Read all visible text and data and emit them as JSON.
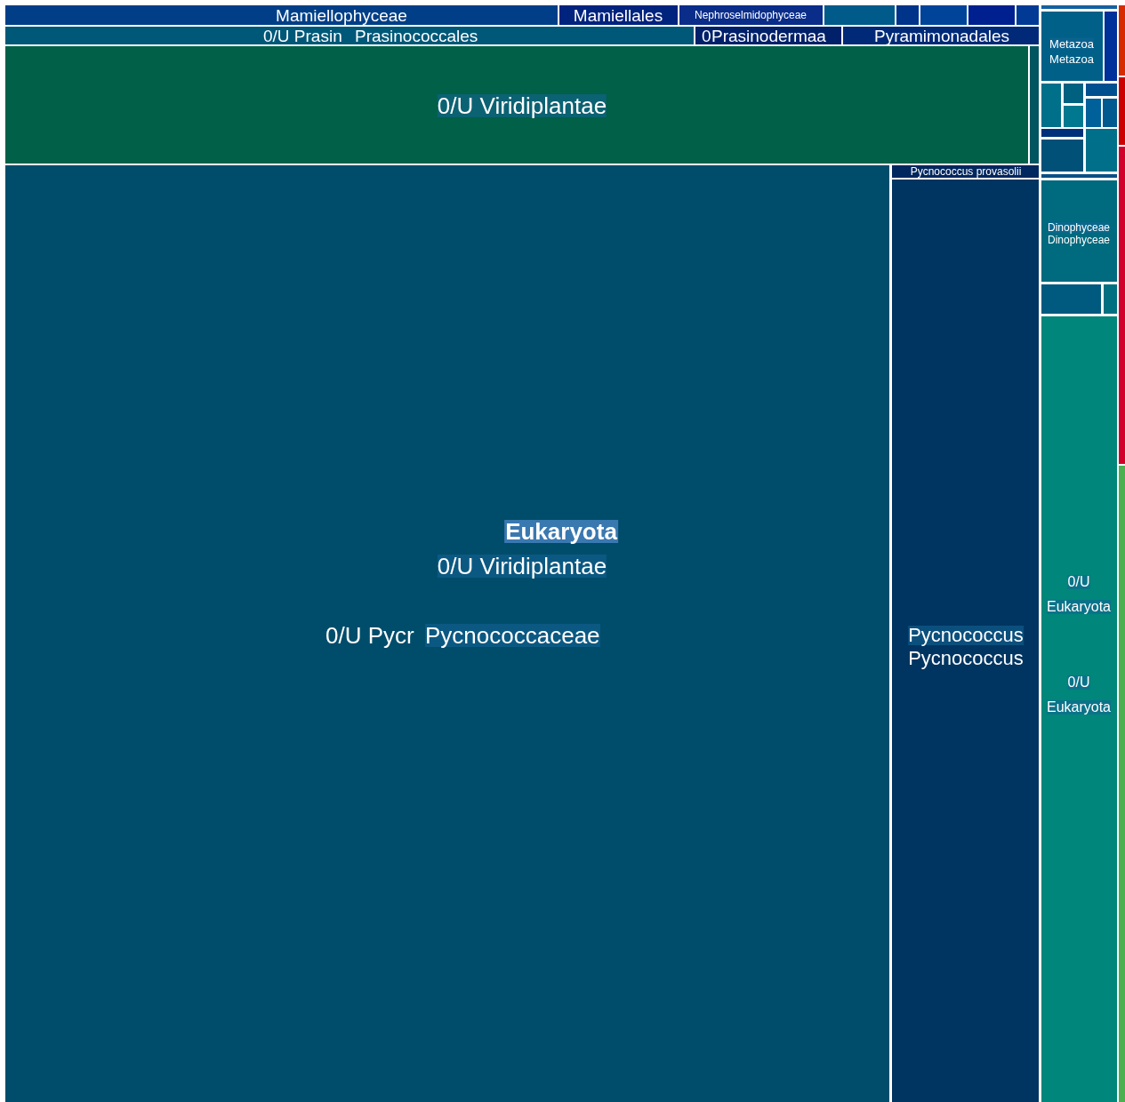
{
  "treemap": {
    "tiles": [
      {
        "color": "#003f87",
        "labels": [
          {
            "text": "Mamiellophyceae",
            "kind": "plain"
          }
        ]
      },
      {
        "color": "#00237e",
        "labels": [
          {
            "text": "Mamiellales",
            "kind": "plain"
          }
        ]
      },
      {
        "color": "#0a2d8a",
        "labels": [
          {
            "text": "Nephroselmidophyceae",
            "kind": "plain"
          }
        ]
      },
      {
        "color": "#005a8a"
      },
      {
        "color": "#00338a"
      },
      {
        "color": "#00449a"
      },
      {
        "color": "#00208f"
      },
      {
        "color": "#003a95"
      },
      {
        "color": "#005878",
        "labels": [
          {
            "text": "0/U Prasin",
            "kind": "plain"
          },
          {
            "text": "Prasinococcales",
            "kind": "plain"
          }
        ]
      },
      {
        "color": "#00206a",
        "labels": [
          {
            "text": "0",
            "kind": "plain"
          },
          {
            "text": "Prasinodermaa",
            "kind": "plain"
          }
        ]
      },
      {
        "color": "#002a78",
        "labels": [
          {
            "text": "Pyramimonadales",
            "kind": "plain"
          }
        ]
      },
      {
        "color": "#006048",
        "labels": [
          {
            "text": "0/U Viridiplantae",
            "kind": "boxed"
          }
        ]
      },
      {
        "color": "#005560"
      },
      {
        "color": "#004d6b",
        "labels": [
          {
            "text": "Eukaryota",
            "kind": "bold"
          },
          {
            "text": "0/U Viridiplantae",
            "kind": "boxed"
          },
          {
            "text": "0/U Pycr",
            "kind": "plain"
          },
          {
            "text": "Pycnococcaceae",
            "kind": "boxed"
          }
        ]
      },
      {
        "color": "#00275e",
        "labels": [
          {
            "text": "Pycnococcus provasolii",
            "kind": "plain"
          }
        ]
      },
      {
        "color": "#003561",
        "labels": [
          {
            "text": "Pycnococcus",
            "kind": "boxed"
          },
          {
            "text": "Pycnococcus",
            "kind": "plain"
          }
        ]
      },
      {
        "color": "#1560a0"
      },
      {
        "color": "#006088",
        "labels": [
          {
            "text": "Metazoa",
            "kind": "boxed"
          },
          {
            "text": "Metazoa",
            "kind": "plain"
          }
        ]
      },
      {
        "color": "#00309a"
      },
      {
        "color": "#006f8a"
      },
      {
        "color": "#006080"
      },
      {
        "color": "#00788f"
      },
      {
        "color": "#00508f"
      },
      {
        "color": "#00609a"
      },
      {
        "color": "#005a90"
      },
      {
        "color": "#00307a"
      },
      {
        "color": "#005078"
      },
      {
        "color": "#00708a"
      },
      {
        "color": "#0a4f86"
      },
      {
        "color": "#006a7e",
        "labels": [
          {
            "text": "Dinophyceae",
            "kind": "boxed"
          },
          {
            "text": "Dinophyceae",
            "kind": "plain"
          }
        ]
      },
      {
        "color": "#005a80"
      },
      {
        "color": "#007080"
      },
      {
        "color": "#00867a",
        "labels": [
          {
            "text": "0/U",
            "kind": "boxed"
          },
          {
            "text": "Eukaryota",
            "kind": "boxed"
          },
          {
            "text": "0/U",
            "kind": "boxed"
          },
          {
            "text": "Eukaryota",
            "kind": "boxed"
          }
        ]
      },
      {
        "color": "#d62a00"
      },
      {
        "color": "#cc0000"
      },
      {
        "color": "#d0002b"
      },
      {
        "color": "#4caf50"
      }
    ]
  }
}
